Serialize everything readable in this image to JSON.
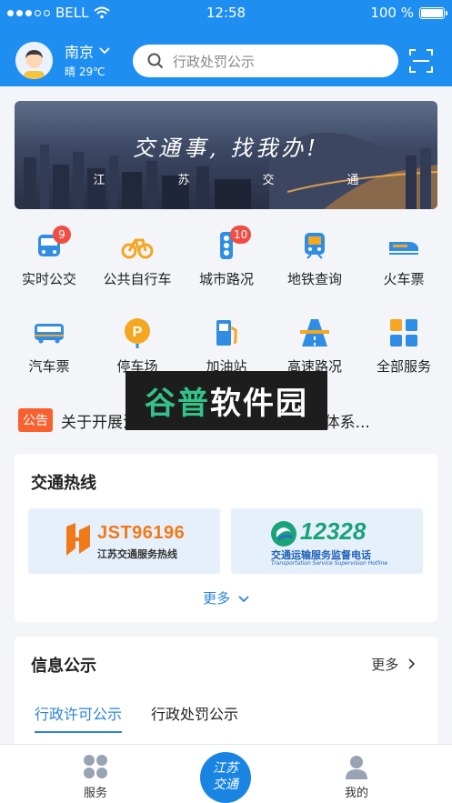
{
  "status_bar": {
    "carrier": "BELL",
    "time": "12:58",
    "battery": "100 %"
  },
  "header": {
    "city": "南京",
    "weather": "晴  29℃",
    "search_placeholder": "行政处罚公示"
  },
  "banner": {
    "title": "交通事, 找我办!",
    "subtitle": [
      "江",
      "苏",
      "交",
      "通"
    ]
  },
  "services": [
    {
      "label": "实时公交",
      "badge": "9"
    },
    {
      "label": "公共自行车",
      "badge": ""
    },
    {
      "label": "城市路况",
      "badge": "10"
    },
    {
      "label": "地铁查询",
      "badge": ""
    },
    {
      "label": "火车票",
      "badge": ""
    },
    {
      "label": "汽车票",
      "badge": ""
    },
    {
      "label": "停车场",
      "badge": ""
    },
    {
      "label": "加油站",
      "badge": ""
    },
    {
      "label": "高速路况",
      "badge": ""
    },
    {
      "label": "全部服务",
      "badge": ""
    }
  ],
  "notice": {
    "tag": "公告",
    "text": "关于开展江苏省“十四五”综合交通运输体系..."
  },
  "watermark": {
    "a": "谷普",
    "b": "软件园"
  },
  "hotline": {
    "title": "交通热线",
    "hotline1_number": "JST96196",
    "hotline1_caption": "江苏交通服务热线",
    "hotline2_number": "12328",
    "hotline2_caption": "交通运输服务监督电话",
    "hotline2_caption_en": "Transportation Service Supervision Hotline",
    "more": "更多"
  },
  "info": {
    "title": "信息公示",
    "more": "更多",
    "tabs": [
      "行政许可公示",
      "行政处罚公示"
    ]
  },
  "bottom_nav": {
    "left": "服务",
    "center_line1": "江苏",
    "center_line2": "交通",
    "right": "我的"
  },
  "colors": {
    "brand": "#1f8ef1",
    "accent": "#2a84d8",
    "badge": "#f04d43",
    "notice_tag": "#f7612f"
  }
}
